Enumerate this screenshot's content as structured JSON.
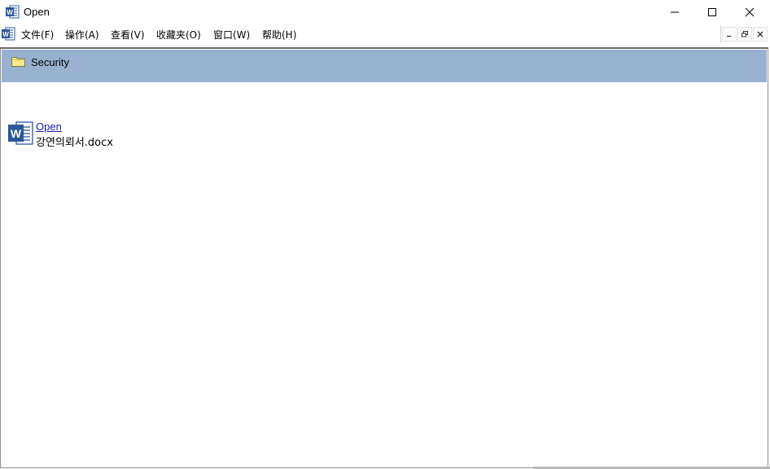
{
  "window": {
    "title": "Open",
    "icon": "word-doc-icon"
  },
  "caption_buttons": {
    "minimize_icon": "minimize-icon",
    "maximize_icon": "maximize-icon",
    "close_icon": "close-icon"
  },
  "menu": {
    "items": [
      {
        "label": "文件(F)"
      },
      {
        "label": "操作(A)"
      },
      {
        "label": "查看(V)"
      },
      {
        "label": "收藏夹(O)"
      },
      {
        "label": "窗口(W)"
      },
      {
        "label": "帮助(H)"
      }
    ]
  },
  "header": {
    "label": "Security",
    "icon": "folder-icon",
    "band_color": "#98b1d1"
  },
  "file": {
    "link_text": "Open",
    "file_name": "강연의뢰서.docx",
    "icon": "word-doc-icon",
    "link_color": "#1a1aa6"
  },
  "colors": {
    "word_blue": "#2b579a"
  }
}
